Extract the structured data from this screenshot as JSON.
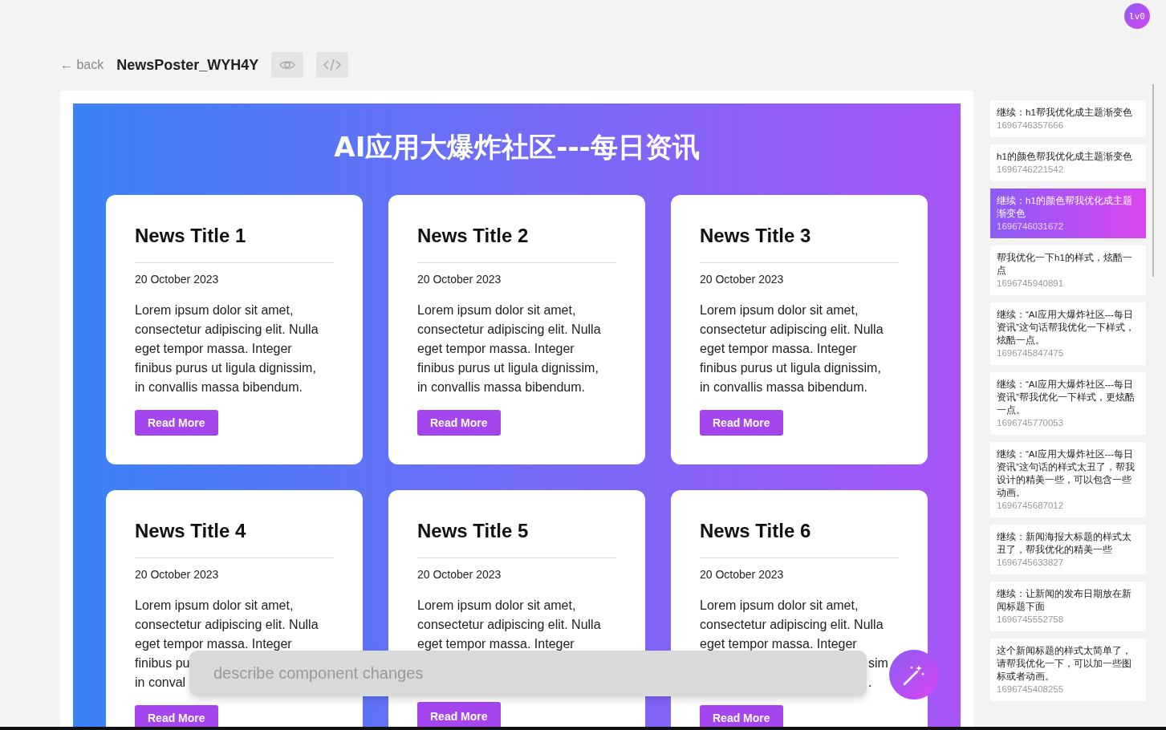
{
  "avatar": {
    "label": "lv0"
  },
  "header": {
    "back": "← back",
    "title": "NewsPoster_WYH4Y"
  },
  "poster": {
    "heading": "AI应用大爆炸社区---每日资讯",
    "cards": [
      {
        "title": "News Title 1",
        "date": "20 October 2023",
        "lines": [
          {
            "kind": "line",
            "text": "Lorem ipsum dolor sit amet,"
          },
          {
            "kind": "line",
            "text": "consectetur adipiscing elit. Nulla"
          },
          {
            "kind": "line",
            "text": "eget tempor massa. Integer"
          },
          {
            "kind": "line",
            "text": "finibus purus ut ligula dignissim,"
          },
          {
            "kind": "line",
            "text": "in convallis massa bibendum."
          }
        ],
        "button": "Read More"
      },
      {
        "title": "News Title 2",
        "date": "20 October 2023",
        "lines": [
          {
            "kind": "line",
            "text": "Lorem ipsum dolor sit amet,"
          },
          {
            "kind": "line",
            "text": "consectetur adipiscing elit. Nulla"
          },
          {
            "kind": "line",
            "text": "eget tempor massa. Integer"
          },
          {
            "kind": "line",
            "text": "finibus purus ut ligula dignissim,"
          },
          {
            "kind": "line",
            "text": "in convallis massa bibendum."
          }
        ],
        "button": "Read More"
      },
      {
        "title": "News Title 3",
        "date": "20 October 2023",
        "lines": [
          {
            "kind": "line",
            "text": "Lorem ipsum dolor sit amet,"
          },
          {
            "kind": "line",
            "text": "consectetur adipiscing elit. Nulla"
          },
          {
            "kind": "line",
            "text": "eget tempor massa. Integer"
          },
          {
            "kind": "line",
            "text": "finibus purus ut ligula dignissim,"
          },
          {
            "kind": "line",
            "text": "in convallis massa bibendum."
          }
        ],
        "button": "Read More"
      },
      {
        "title": "News Title 4",
        "date": "20 October 2023",
        "lines": [
          {
            "kind": "line",
            "text": "Lorem ipsum dolor sit amet,"
          },
          {
            "kind": "line",
            "text": "consectetur adipiscing elit. Nulla"
          },
          {
            "kind": "line",
            "text": "eget tempor massa. Integer"
          },
          {
            "kind": "line",
            "text": "finibus pu"
          },
          {
            "kind": "line",
            "text": "in conval"
          }
        ],
        "button": "Read More"
      },
      {
        "title": "News Title 5",
        "date": "20 October 2023",
        "lines": [
          {
            "kind": "line",
            "text": "Lorem ipsum dolor sit amet,"
          },
          {
            "kind": "line",
            "text": "consectetur adipiscing elit. Nulla"
          },
          {
            "kind": "line",
            "text": "eget tempor massa. Integer"
          }
        ],
        "button": "Read More"
      },
      {
        "title": "News Title 6",
        "date": "20 October 2023",
        "lines": [
          {
            "kind": "line",
            "text": "Lorem ipsum dolor sit amet,"
          },
          {
            "kind": "line",
            "text": "consectetur adipiscing elit. Nulla"
          },
          {
            "kind": "line",
            "text": "eget tempor massa. Integer"
          },
          {
            "kind": "tail",
            "text": "sim"
          },
          {
            "kind": "tail",
            "text": "."
          }
        ],
        "button": "Read More"
      }
    ]
  },
  "prompt": {
    "placeholder": "describe component changes"
  },
  "history": [
    {
      "text": "继续：h1帮我优化成主题渐变色",
      "time": "1696746357666",
      "selected": false
    },
    {
      "text": "h1的颜色帮我优化成主题渐变色",
      "time": "1696746221542",
      "selected": false
    },
    {
      "text": "继续：h1的颜色帮我优化成主题渐变色",
      "time": "1696746031672",
      "selected": true
    },
    {
      "text": "帮我优化一下h1的样式，炫酷一点",
      "time": "1696745940891",
      "selected": false
    },
    {
      "text": "继续：“AI应用大爆炸社区---每日资讯”这句话帮我优化一下样式，炫酷一点。",
      "time": "1696745847475",
      "selected": false
    },
    {
      "text": "继续：“AI应用大爆炸社区---每日资讯”帮我优化一下样式，更炫酷一点。",
      "time": "1696745770053",
      "selected": false
    },
    {
      "text": "继续：“AI应用大爆炸社区---每日资讯”这句话的样式太丑了，帮我设计的精美一些，可以包含一些动画。",
      "time": "1696745687012",
      "selected": false
    },
    {
      "text": "继续：新闻海报大标题的样式太丑了，帮我优化的精美一些",
      "time": "1696745633827",
      "selected": false
    },
    {
      "text": "继续：让新闻的发布日期放在新闻标题下面",
      "time": "1696745552758",
      "selected": false
    },
    {
      "text": "这个新闻标题的样式太简单了，请帮我优化一下，可以加一些图标或者动画。",
      "time": "1696745408255",
      "selected": false
    }
  ]
}
